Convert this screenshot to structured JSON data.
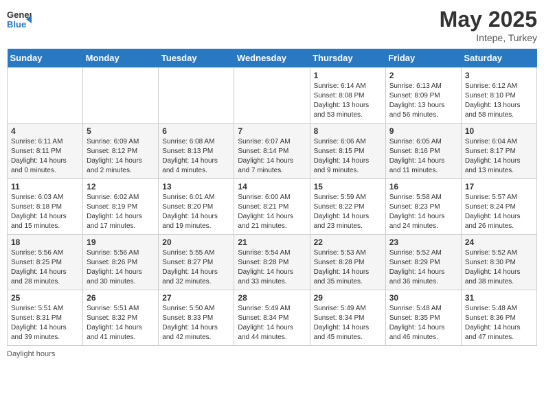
{
  "header": {
    "logo_general": "General",
    "logo_blue": "Blue",
    "month": "May 2025",
    "location": "Intepe, Turkey"
  },
  "days_of_week": [
    "Sunday",
    "Monday",
    "Tuesday",
    "Wednesday",
    "Thursday",
    "Friday",
    "Saturday"
  ],
  "footer": {
    "daylight_note": "Daylight hours"
  },
  "weeks": [
    [
      {
        "day": "",
        "sunrise": "",
        "sunset": "",
        "daylight": ""
      },
      {
        "day": "",
        "sunrise": "",
        "sunset": "",
        "daylight": ""
      },
      {
        "day": "",
        "sunrise": "",
        "sunset": "",
        "daylight": ""
      },
      {
        "day": "",
        "sunrise": "",
        "sunset": "",
        "daylight": ""
      },
      {
        "day": "1",
        "sunrise": "Sunrise: 6:14 AM",
        "sunset": "Sunset: 8:08 PM",
        "daylight": "Daylight: 13 hours and 53 minutes."
      },
      {
        "day": "2",
        "sunrise": "Sunrise: 6:13 AM",
        "sunset": "Sunset: 8:09 PM",
        "daylight": "Daylight: 13 hours and 56 minutes."
      },
      {
        "day": "3",
        "sunrise": "Sunrise: 6:12 AM",
        "sunset": "Sunset: 8:10 PM",
        "daylight": "Daylight: 13 hours and 58 minutes."
      }
    ],
    [
      {
        "day": "4",
        "sunrise": "Sunrise: 6:11 AM",
        "sunset": "Sunset: 8:11 PM",
        "daylight": "Daylight: 14 hours and 0 minutes."
      },
      {
        "day": "5",
        "sunrise": "Sunrise: 6:09 AM",
        "sunset": "Sunset: 8:12 PM",
        "daylight": "Daylight: 14 hours and 2 minutes."
      },
      {
        "day": "6",
        "sunrise": "Sunrise: 6:08 AM",
        "sunset": "Sunset: 8:13 PM",
        "daylight": "Daylight: 14 hours and 4 minutes."
      },
      {
        "day": "7",
        "sunrise": "Sunrise: 6:07 AM",
        "sunset": "Sunset: 8:14 PM",
        "daylight": "Daylight: 14 hours and 7 minutes."
      },
      {
        "day": "8",
        "sunrise": "Sunrise: 6:06 AM",
        "sunset": "Sunset: 8:15 PM",
        "daylight": "Daylight: 14 hours and 9 minutes."
      },
      {
        "day": "9",
        "sunrise": "Sunrise: 6:05 AM",
        "sunset": "Sunset: 8:16 PM",
        "daylight": "Daylight: 14 hours and 11 minutes."
      },
      {
        "day": "10",
        "sunrise": "Sunrise: 6:04 AM",
        "sunset": "Sunset: 8:17 PM",
        "daylight": "Daylight: 14 hours and 13 minutes."
      }
    ],
    [
      {
        "day": "11",
        "sunrise": "Sunrise: 6:03 AM",
        "sunset": "Sunset: 8:18 PM",
        "daylight": "Daylight: 14 hours and 15 minutes."
      },
      {
        "day": "12",
        "sunrise": "Sunrise: 6:02 AM",
        "sunset": "Sunset: 8:19 PM",
        "daylight": "Daylight: 14 hours and 17 minutes."
      },
      {
        "day": "13",
        "sunrise": "Sunrise: 6:01 AM",
        "sunset": "Sunset: 8:20 PM",
        "daylight": "Daylight: 14 hours and 19 minutes."
      },
      {
        "day": "14",
        "sunrise": "Sunrise: 6:00 AM",
        "sunset": "Sunset: 8:21 PM",
        "daylight": "Daylight: 14 hours and 21 minutes."
      },
      {
        "day": "15",
        "sunrise": "Sunrise: 5:59 AM",
        "sunset": "Sunset: 8:22 PM",
        "daylight": "Daylight: 14 hours and 23 minutes."
      },
      {
        "day": "16",
        "sunrise": "Sunrise: 5:58 AM",
        "sunset": "Sunset: 8:23 PM",
        "daylight": "Daylight: 14 hours and 24 minutes."
      },
      {
        "day": "17",
        "sunrise": "Sunrise: 5:57 AM",
        "sunset": "Sunset: 8:24 PM",
        "daylight": "Daylight: 14 hours and 26 minutes."
      }
    ],
    [
      {
        "day": "18",
        "sunrise": "Sunrise: 5:56 AM",
        "sunset": "Sunset: 8:25 PM",
        "daylight": "Daylight: 14 hours and 28 minutes."
      },
      {
        "day": "19",
        "sunrise": "Sunrise: 5:56 AM",
        "sunset": "Sunset: 8:26 PM",
        "daylight": "Daylight: 14 hours and 30 minutes."
      },
      {
        "day": "20",
        "sunrise": "Sunrise: 5:55 AM",
        "sunset": "Sunset: 8:27 PM",
        "daylight": "Daylight: 14 hours and 32 minutes."
      },
      {
        "day": "21",
        "sunrise": "Sunrise: 5:54 AM",
        "sunset": "Sunset: 8:28 PM",
        "daylight": "Daylight: 14 hours and 33 minutes."
      },
      {
        "day": "22",
        "sunrise": "Sunrise: 5:53 AM",
        "sunset": "Sunset: 8:28 PM",
        "daylight": "Daylight: 14 hours and 35 minutes."
      },
      {
        "day": "23",
        "sunrise": "Sunrise: 5:52 AM",
        "sunset": "Sunset: 8:29 PM",
        "daylight": "Daylight: 14 hours and 36 minutes."
      },
      {
        "day": "24",
        "sunrise": "Sunrise: 5:52 AM",
        "sunset": "Sunset: 8:30 PM",
        "daylight": "Daylight: 14 hours and 38 minutes."
      }
    ],
    [
      {
        "day": "25",
        "sunrise": "Sunrise: 5:51 AM",
        "sunset": "Sunset: 8:31 PM",
        "daylight": "Daylight: 14 hours and 39 minutes."
      },
      {
        "day": "26",
        "sunrise": "Sunrise: 5:51 AM",
        "sunset": "Sunset: 8:32 PM",
        "daylight": "Daylight: 14 hours and 41 minutes."
      },
      {
        "day": "27",
        "sunrise": "Sunrise: 5:50 AM",
        "sunset": "Sunset: 8:33 PM",
        "daylight": "Daylight: 14 hours and 42 minutes."
      },
      {
        "day": "28",
        "sunrise": "Sunrise: 5:49 AM",
        "sunset": "Sunset: 8:34 PM",
        "daylight": "Daylight: 14 hours and 44 minutes."
      },
      {
        "day": "29",
        "sunrise": "Sunrise: 5:49 AM",
        "sunset": "Sunset: 8:34 PM",
        "daylight": "Daylight: 14 hours and 45 minutes."
      },
      {
        "day": "30",
        "sunrise": "Sunrise: 5:48 AM",
        "sunset": "Sunset: 8:35 PM",
        "daylight": "Daylight: 14 hours and 46 minutes."
      },
      {
        "day": "31",
        "sunrise": "Sunrise: 5:48 AM",
        "sunset": "Sunset: 8:36 PM",
        "daylight": "Daylight: 14 hours and 47 minutes."
      }
    ]
  ]
}
